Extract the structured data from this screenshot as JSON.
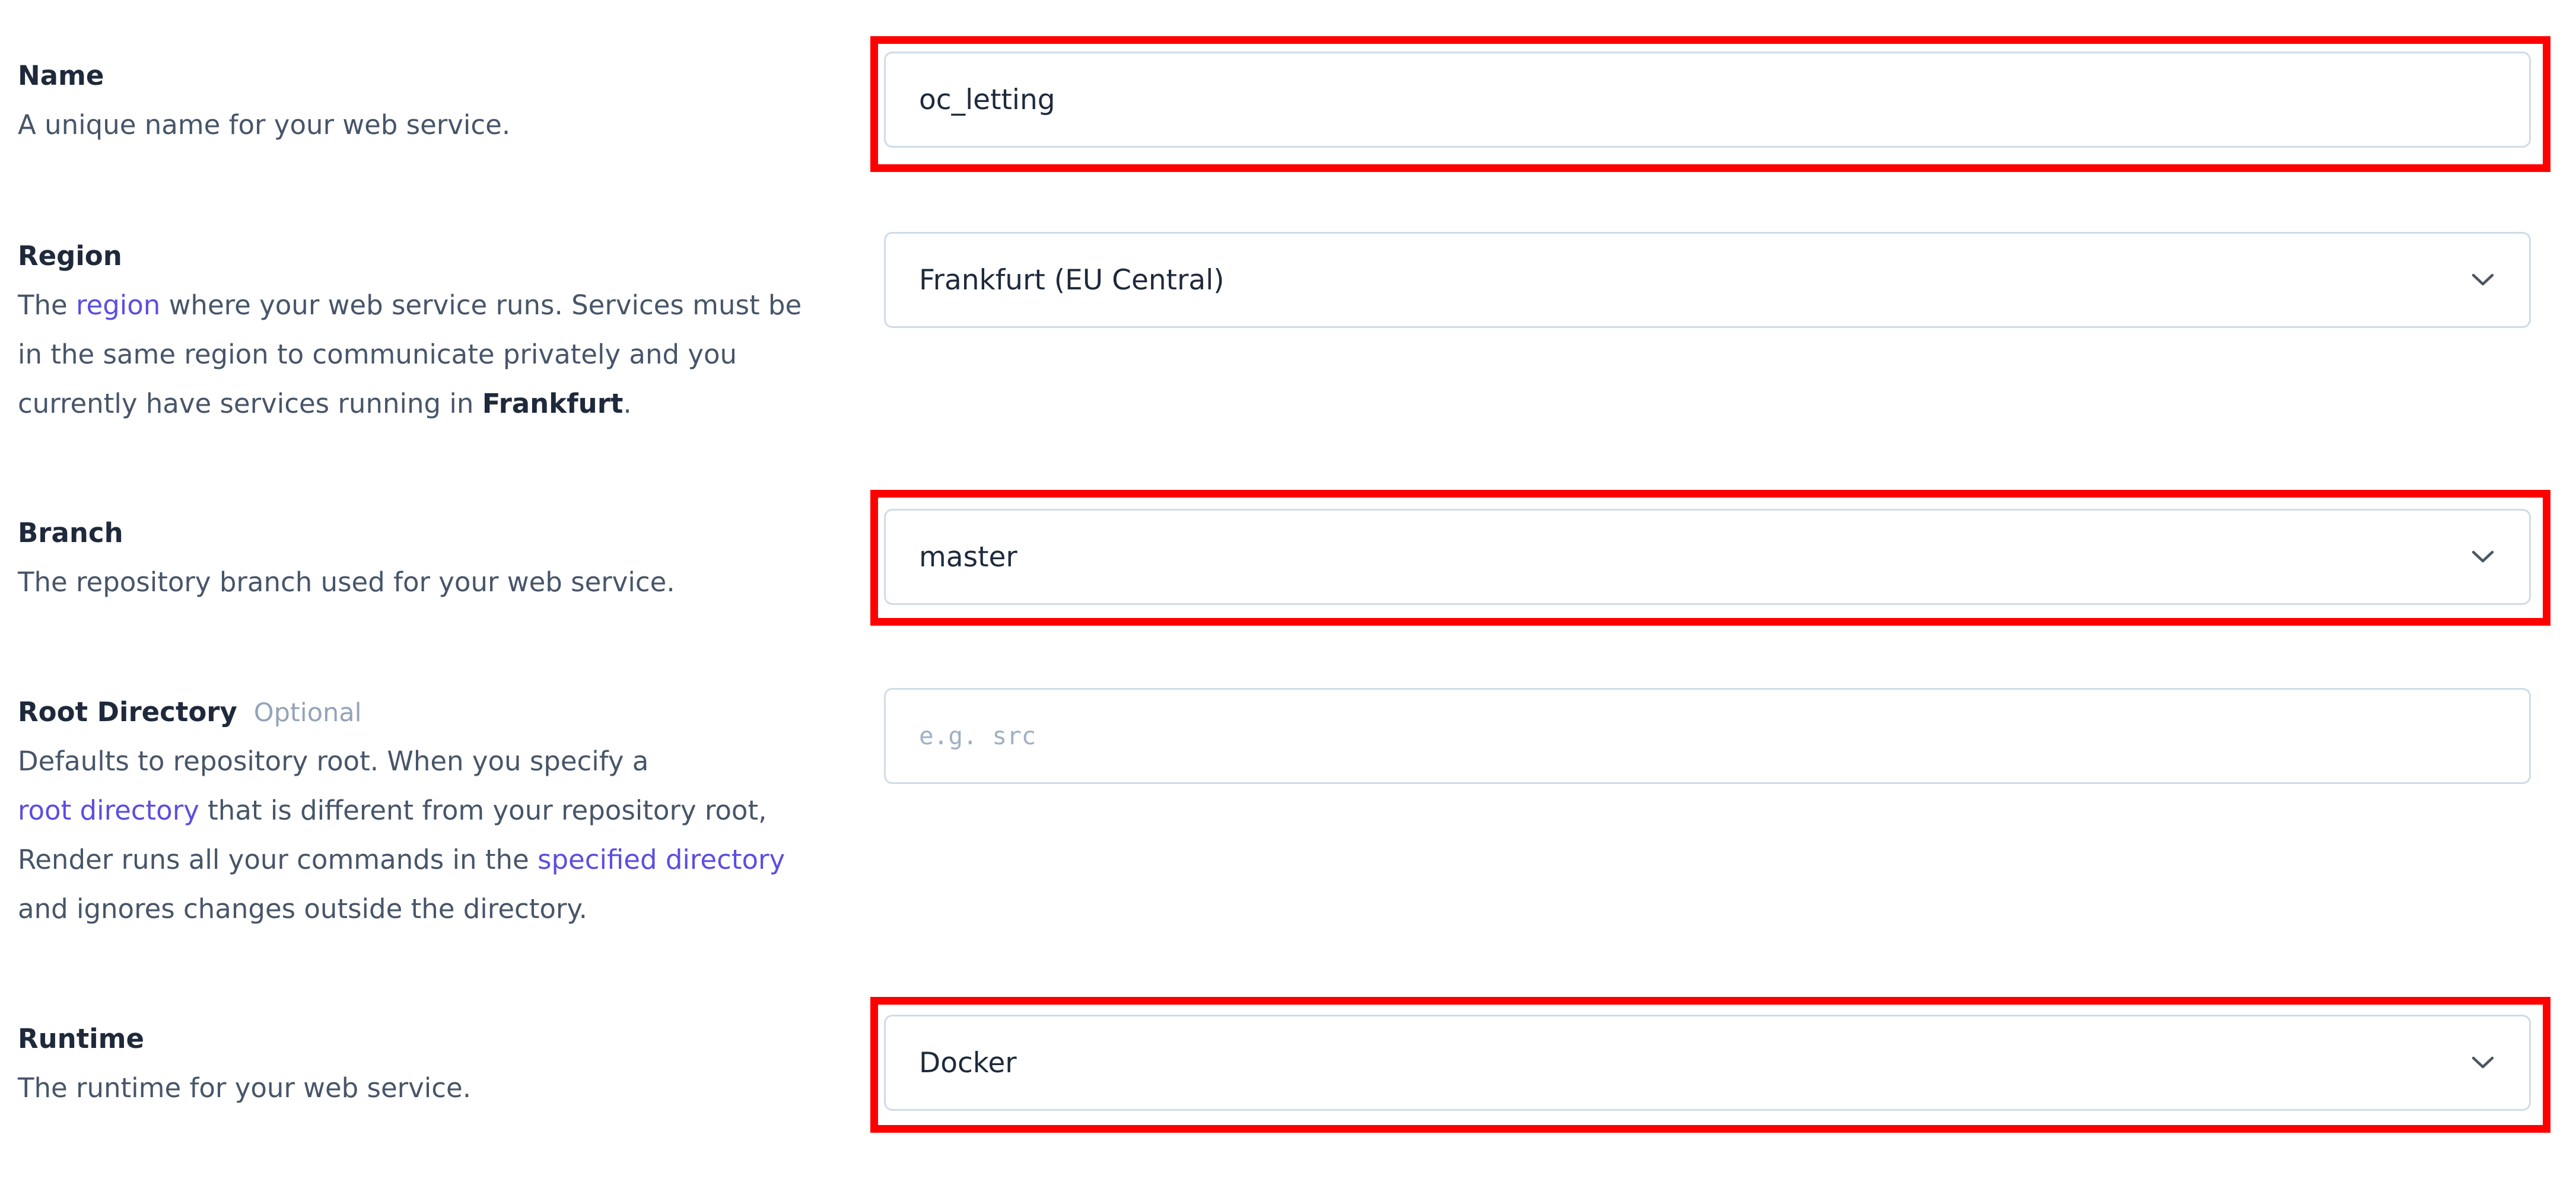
{
  "fields": {
    "name": {
      "title": "Name",
      "description": "A unique name for your web service.",
      "value": "oc_letting"
    },
    "region": {
      "title": "Region",
      "desc_pre": "The ",
      "desc_link": "region",
      "desc_line1_rest": " where your web service runs. Services must be",
      "desc_line2": "in the same region to communicate privately and you",
      "desc_line3_pre": "currently have services running in ",
      "desc_line3_bold": "Frankfurt",
      "desc_line3_post": ".",
      "value": "Frankfurt (EU Central)"
    },
    "branch": {
      "title": "Branch",
      "description": "The repository branch used for your web service.",
      "value": "master"
    },
    "root_directory": {
      "title": "Root Directory",
      "optional_label": "Optional",
      "desc_line1": "Defaults to repository root. When you specify a",
      "desc_line2_link": "root directory",
      "desc_line2_rest": " that is different from your repository root,",
      "desc_line3_pre": "Render runs all your commands in the ",
      "desc_line3_link": "specified directory",
      "desc_line4": "and ignores changes outside the directory.",
      "placeholder": "e.g. src",
      "value": ""
    },
    "runtime": {
      "title": "Runtime",
      "description": "The runtime for your web service.",
      "value": "Docker"
    }
  },
  "icons": {
    "dropdown": "chevron-down-icon"
  },
  "colors": {
    "highlight": "#ff0000",
    "link": "#5b4ee0",
    "input_border": "#cfdce8"
  }
}
